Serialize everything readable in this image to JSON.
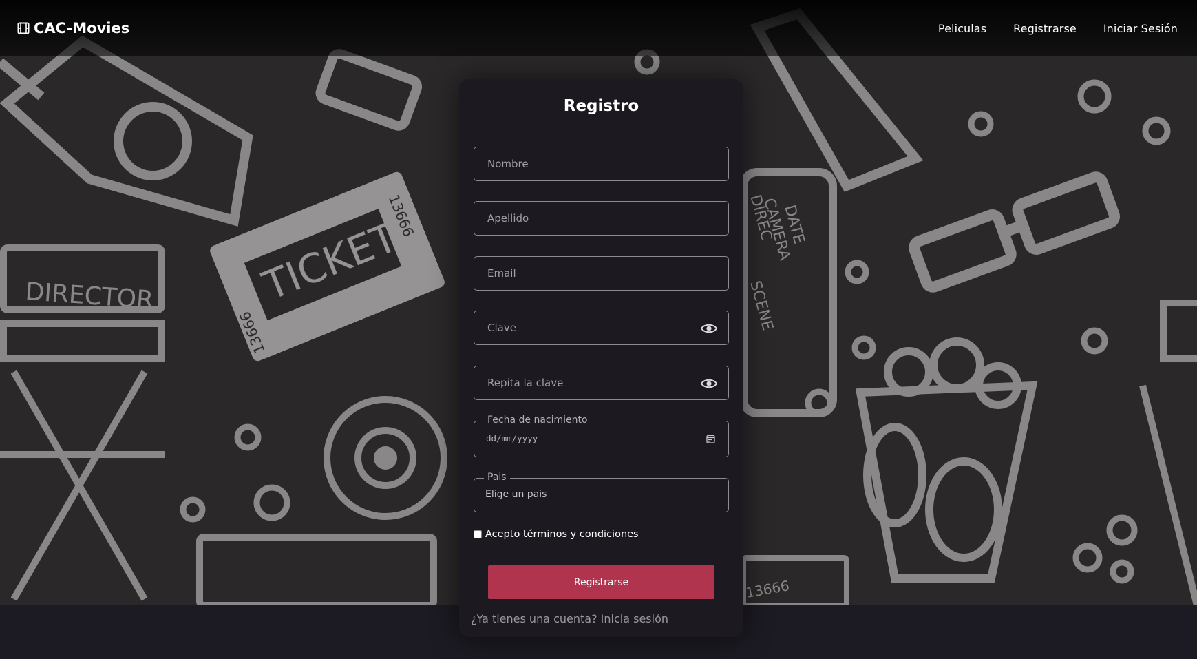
{
  "header": {
    "brand_label": "CAC-Movies",
    "brand_icon": "film-icon",
    "nav": [
      "Peliculas",
      "Registrarse",
      "Iniciar Sesión"
    ]
  },
  "form": {
    "title": "Registro",
    "nombre_placeholder": "Nombre",
    "apellido_placeholder": "Apellido",
    "email_placeholder": "Email",
    "clave_placeholder": "Clave",
    "repita_placeholder": "Repita la clave",
    "fecha_label": "Fecha de nacimiento",
    "fecha_value": "dd/mm/yyyy",
    "pais_label": "Pais",
    "pais_value": "Elige un pais",
    "terms_label": "Acepto términos y condiciones",
    "terms_checked": false,
    "submit_label": "Registrarse",
    "login_link": "¿Ya tienes una cuenta? Inicia sesión"
  },
  "colors": {
    "accent": "#b0344d",
    "card_bg": "#1c1a20",
    "page_bg": "#2a2828"
  },
  "background": {
    "texts": [
      "DIRECTOR",
      "TICKET",
      "13666",
      "13666",
      "DATE",
      "CAMERA",
      "DIREC",
      "SCENE",
      "13666"
    ]
  }
}
